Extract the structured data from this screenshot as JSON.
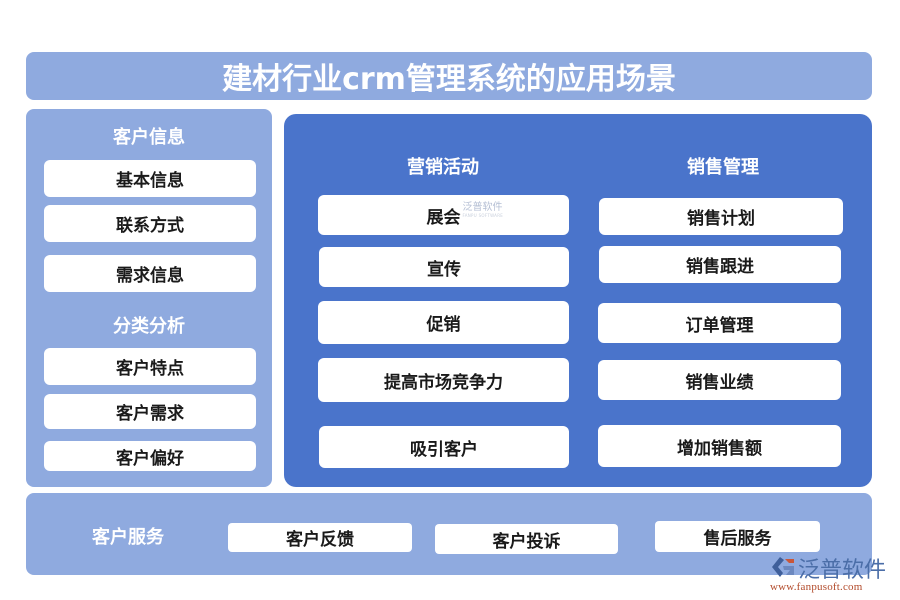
{
  "title": "建材行业crm管理系统的应用场景",
  "colors": {
    "light_panel": "#8faadf",
    "dark_panel": "#4a74cb",
    "card": "#ffffff",
    "card_text": "#1a1a1a",
    "heading_text": "#ffffff"
  },
  "left_panel": {
    "groups": [
      {
        "heading": "客户信息",
        "items": [
          "基本信息",
          "联系方式",
          "需求信息"
        ]
      },
      {
        "heading": "分类分析",
        "items": [
          "客户特点",
          "客户需求",
          "客户偏好"
        ]
      }
    ]
  },
  "main_panel": {
    "columns": [
      {
        "heading": "营销活动",
        "items": [
          "展会",
          "宣传",
          "促销",
          "提高市场竞争力",
          "吸引客户"
        ]
      },
      {
        "heading": "销售管理",
        "items": [
          "销售计划",
          "销售跟进",
          "订单管理",
          "销售业绩",
          "增加销售额"
        ]
      }
    ]
  },
  "bottom_panel": {
    "heading": "客户服务",
    "items": [
      "客户反馈",
      "客户投诉",
      "售后服务"
    ]
  },
  "watermark": {
    "inline_cn": "泛普软件",
    "inline_en": "FANPU SOFTWARE",
    "logo_icon": "fanpu-logo-icon",
    "logo_cn": "泛普软件",
    "logo_url": "www.fanpusoft.com"
  }
}
